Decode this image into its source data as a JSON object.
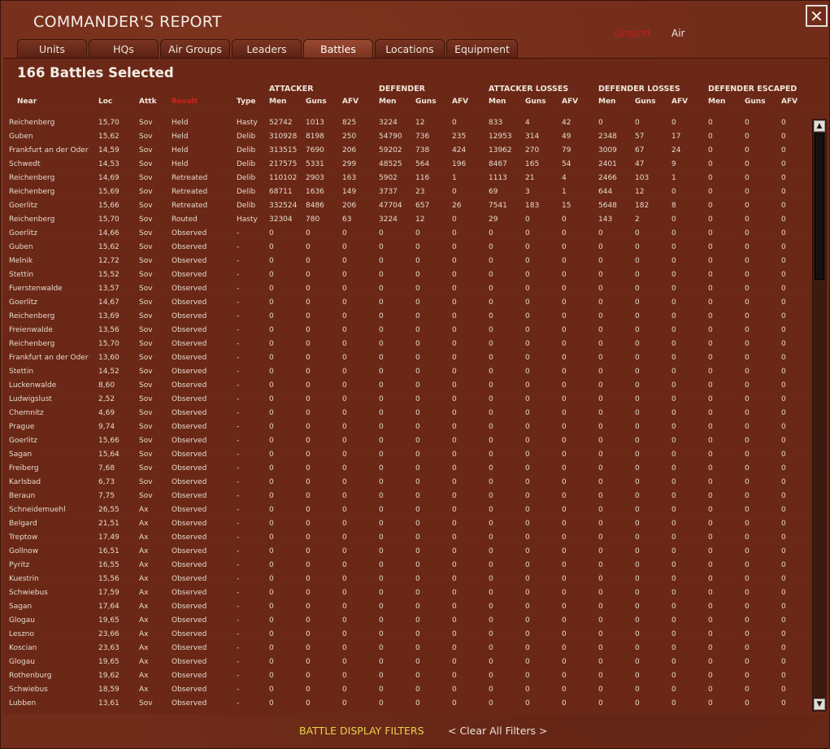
{
  "title": "COMMANDER'S REPORT",
  "close_label": "✕",
  "mode": {
    "ground": "Ground",
    "air": "Air"
  },
  "tabs": [
    "Units",
    "HQs",
    "Air Groups",
    "Leaders",
    "Battles",
    "Locations",
    "Equipment"
  ],
  "active_tab": "Battles",
  "selected_count": "166 Battles Selected",
  "group_headers": [
    "ATTACKER",
    "DEFENDER",
    "ATTACKER LOSSES",
    "DEFENDER LOSSES",
    "DEFENDER ESCAPED"
  ],
  "columns": [
    "Near",
    "Loc",
    "Attk",
    "Result",
    "Type",
    "Men",
    "Guns",
    "AFV",
    "Men",
    "Guns",
    "AFV",
    "Men",
    "Guns",
    "AFV",
    "Men",
    "Guns",
    "AFV",
    "Men",
    "Guns",
    "AFV"
  ],
  "sorted_column": "Result",
  "rows": [
    [
      "Reichenberg",
      "15,70",
      "Sov",
      "Held",
      "Hasty",
      "52742",
      "1013",
      "825",
      "3224",
      "12",
      "0",
      "833",
      "4",
      "42",
      "0",
      "0",
      "0",
      "0",
      "0",
      "0"
    ],
    [
      "Guben",
      "15,62",
      "Sov",
      "Held",
      "Delib",
      "310928",
      "8198",
      "250",
      "54790",
      "736",
      "235",
      "12953",
      "314",
      "49",
      "2348",
      "57",
      "17",
      "0",
      "0",
      "0"
    ],
    [
      "Frankfurt an der Oder",
      "14,59",
      "Sov",
      "Held",
      "Delib",
      "313515",
      "7690",
      "206",
      "59202",
      "738",
      "424",
      "13962",
      "270",
      "79",
      "3009",
      "67",
      "24",
      "0",
      "0",
      "0"
    ],
    [
      "Schwedt",
      "14,53",
      "Sov",
      "Held",
      "Delib",
      "217575",
      "5331",
      "299",
      "48525",
      "564",
      "196",
      "8467",
      "165",
      "54",
      "2401",
      "47",
      "9",
      "0",
      "0",
      "0"
    ],
    [
      "Reichenberg",
      "14,69",
      "Sov",
      "Retreated",
      "Delib",
      "110102",
      "2903",
      "163",
      "5902",
      "116",
      "1",
      "1113",
      "21",
      "4",
      "2466",
      "103",
      "1",
      "0",
      "0",
      "0"
    ],
    [
      "Reichenberg",
      "15,69",
      "Sov",
      "Retreated",
      "Delib",
      "68711",
      "1636",
      "149",
      "3737",
      "23",
      "0",
      "69",
      "3",
      "1",
      "644",
      "12",
      "0",
      "0",
      "0",
      "0"
    ],
    [
      "Goerlitz",
      "15,66",
      "Sov",
      "Retreated",
      "Delib",
      "332524",
      "8486",
      "206",
      "47704",
      "657",
      "26",
      "7541",
      "183",
      "15",
      "5648",
      "182",
      "8",
      "0",
      "0",
      "0"
    ],
    [
      "Reichenberg",
      "15,70",
      "Sov",
      "Routed",
      "Hasty",
      "32304",
      "780",
      "63",
      "3224",
      "12",
      "0",
      "29",
      "0",
      "0",
      "143",
      "2",
      "0",
      "0",
      "0",
      "0"
    ],
    [
      "Goerlitz",
      "14,66",
      "Sov",
      "Observed",
      "-",
      "0",
      "0",
      "0",
      "0",
      "0",
      "0",
      "0",
      "0",
      "0",
      "0",
      "0",
      "0",
      "0",
      "0",
      "0"
    ],
    [
      "Guben",
      "15,62",
      "Sov",
      "Observed",
      "-",
      "0",
      "0",
      "0",
      "0",
      "0",
      "0",
      "0",
      "0",
      "0",
      "0",
      "0",
      "0",
      "0",
      "0",
      "0"
    ],
    [
      "Melnik",
      "12,72",
      "Sov",
      "Observed",
      "-",
      "0",
      "0",
      "0",
      "0",
      "0",
      "0",
      "0",
      "0",
      "0",
      "0",
      "0",
      "0",
      "0",
      "0",
      "0"
    ],
    [
      "Stettin",
      "15,52",
      "Sov",
      "Observed",
      "-",
      "0",
      "0",
      "0",
      "0",
      "0",
      "0",
      "0",
      "0",
      "0",
      "0",
      "0",
      "0",
      "0",
      "0",
      "0"
    ],
    [
      "Fuerstenwalde",
      "13,57",
      "Sov",
      "Observed",
      "-",
      "0",
      "0",
      "0",
      "0",
      "0",
      "0",
      "0",
      "0",
      "0",
      "0",
      "0",
      "0",
      "0",
      "0",
      "0"
    ],
    [
      "Goerlitz",
      "14,67",
      "Sov",
      "Observed",
      "-",
      "0",
      "0",
      "0",
      "0",
      "0",
      "0",
      "0",
      "0",
      "0",
      "0",
      "0",
      "0",
      "0",
      "0",
      "0"
    ],
    [
      "Reichenberg",
      "13,69",
      "Sov",
      "Observed",
      "-",
      "0",
      "0",
      "0",
      "0",
      "0",
      "0",
      "0",
      "0",
      "0",
      "0",
      "0",
      "0",
      "0",
      "0",
      "0"
    ],
    [
      "Freienwalde",
      "13,56",
      "Sov",
      "Observed",
      "-",
      "0",
      "0",
      "0",
      "0",
      "0",
      "0",
      "0",
      "0",
      "0",
      "0",
      "0",
      "0",
      "0",
      "0",
      "0"
    ],
    [
      "Reichenberg",
      "15,70",
      "Sov",
      "Observed",
      "-",
      "0",
      "0",
      "0",
      "0",
      "0",
      "0",
      "0",
      "0",
      "0",
      "0",
      "0",
      "0",
      "0",
      "0",
      "0"
    ],
    [
      "Frankfurt an der Oder",
      "13,60",
      "Sov",
      "Observed",
      "-",
      "0",
      "0",
      "0",
      "0",
      "0",
      "0",
      "0",
      "0",
      "0",
      "0",
      "0",
      "0",
      "0",
      "0",
      "0"
    ],
    [
      "Stettin",
      "14,52",
      "Sov",
      "Observed",
      "-",
      "0",
      "0",
      "0",
      "0",
      "0",
      "0",
      "0",
      "0",
      "0",
      "0",
      "0",
      "0",
      "0",
      "0",
      "0"
    ],
    [
      "Luckenwalde",
      "8,60",
      "Sov",
      "Observed",
      "-",
      "0",
      "0",
      "0",
      "0",
      "0",
      "0",
      "0",
      "0",
      "0",
      "0",
      "0",
      "0",
      "0",
      "0",
      "0"
    ],
    [
      "Ludwigslust",
      "2,52",
      "Sov",
      "Observed",
      "-",
      "0",
      "0",
      "0",
      "0",
      "0",
      "0",
      "0",
      "0",
      "0",
      "0",
      "0",
      "0",
      "0",
      "0",
      "0"
    ],
    [
      "Chemnitz",
      "4,69",
      "Sov",
      "Observed",
      "-",
      "0",
      "0",
      "0",
      "0",
      "0",
      "0",
      "0",
      "0",
      "0",
      "0",
      "0",
      "0",
      "0",
      "0",
      "0"
    ],
    [
      "Prague",
      "9,74",
      "Sov",
      "Observed",
      "-",
      "0",
      "0",
      "0",
      "0",
      "0",
      "0",
      "0",
      "0",
      "0",
      "0",
      "0",
      "0",
      "0",
      "0",
      "0"
    ],
    [
      "Goerlitz",
      "15,66",
      "Sov",
      "Observed",
      "-",
      "0",
      "0",
      "0",
      "0",
      "0",
      "0",
      "0",
      "0",
      "0",
      "0",
      "0",
      "0",
      "0",
      "0",
      "0"
    ],
    [
      "Sagan",
      "15,64",
      "Sov",
      "Observed",
      "-",
      "0",
      "0",
      "0",
      "0",
      "0",
      "0",
      "0",
      "0",
      "0",
      "0",
      "0",
      "0",
      "0",
      "0",
      "0"
    ],
    [
      "Freiberg",
      "7,68",
      "Sov",
      "Observed",
      "-",
      "0",
      "0",
      "0",
      "0",
      "0",
      "0",
      "0",
      "0",
      "0",
      "0",
      "0",
      "0",
      "0",
      "0",
      "0"
    ],
    [
      "Karlsbad",
      "6,73",
      "Sov",
      "Observed",
      "-",
      "0",
      "0",
      "0",
      "0",
      "0",
      "0",
      "0",
      "0",
      "0",
      "0",
      "0",
      "0",
      "0",
      "0",
      "0"
    ],
    [
      "Beraun",
      "7,75",
      "Sov",
      "Observed",
      "-",
      "0",
      "0",
      "0",
      "0",
      "0",
      "0",
      "0",
      "0",
      "0",
      "0",
      "0",
      "0",
      "0",
      "0",
      "0"
    ],
    [
      "Schneidemuehl",
      "26,55",
      "Ax",
      "Observed",
      "-",
      "0",
      "0",
      "0",
      "0",
      "0",
      "0",
      "0",
      "0",
      "0",
      "0",
      "0",
      "0",
      "0",
      "0",
      "0"
    ],
    [
      "Belgard",
      "21,51",
      "Ax",
      "Observed",
      "-",
      "0",
      "0",
      "0",
      "0",
      "0",
      "0",
      "0",
      "0",
      "0",
      "0",
      "0",
      "0",
      "0",
      "0",
      "0"
    ],
    [
      "Treptow",
      "17,49",
      "Ax",
      "Observed",
      "-",
      "0",
      "0",
      "0",
      "0",
      "0",
      "0",
      "0",
      "0",
      "0",
      "0",
      "0",
      "0",
      "0",
      "0",
      "0"
    ],
    [
      "Gollnow",
      "16,51",
      "Ax",
      "Observed",
      "-",
      "0",
      "0",
      "0",
      "0",
      "0",
      "0",
      "0",
      "0",
      "0",
      "0",
      "0",
      "0",
      "0",
      "0",
      "0"
    ],
    [
      "Pyritz",
      "16,55",
      "Ax",
      "Observed",
      "-",
      "0",
      "0",
      "0",
      "0",
      "0",
      "0",
      "0",
      "0",
      "0",
      "0",
      "0",
      "0",
      "0",
      "0",
      "0"
    ],
    [
      "Kuestrin",
      "15,56",
      "Ax",
      "Observed",
      "-",
      "0",
      "0",
      "0",
      "0",
      "0",
      "0",
      "0",
      "0",
      "0",
      "0",
      "0",
      "0",
      "0",
      "0",
      "0"
    ],
    [
      "Schwiebus",
      "17,59",
      "Ax",
      "Observed",
      "-",
      "0",
      "0",
      "0",
      "0",
      "0",
      "0",
      "0",
      "0",
      "0",
      "0",
      "0",
      "0",
      "0",
      "0",
      "0"
    ],
    [
      "Sagan",
      "17,64",
      "Ax",
      "Observed",
      "-",
      "0",
      "0",
      "0",
      "0",
      "0",
      "0",
      "0",
      "0",
      "0",
      "0",
      "0",
      "0",
      "0",
      "0",
      "0"
    ],
    [
      "Glogau",
      "19,65",
      "Ax",
      "Observed",
      "-",
      "0",
      "0",
      "0",
      "0",
      "0",
      "0",
      "0",
      "0",
      "0",
      "0",
      "0",
      "0",
      "0",
      "0",
      "0"
    ],
    [
      "Leszno",
      "23,66",
      "Ax",
      "Observed",
      "-",
      "0",
      "0",
      "0",
      "0",
      "0",
      "0",
      "0",
      "0",
      "0",
      "0",
      "0",
      "0",
      "0",
      "0",
      "0"
    ],
    [
      "Koscian",
      "23,63",
      "Ax",
      "Observed",
      "-",
      "0",
      "0",
      "0",
      "0",
      "0",
      "0",
      "0",
      "0",
      "0",
      "0",
      "0",
      "0",
      "0",
      "0",
      "0"
    ],
    [
      "Glogau",
      "19,65",
      "Ax",
      "Observed",
      "-",
      "0",
      "0",
      "0",
      "0",
      "0",
      "0",
      "0",
      "0",
      "0",
      "0",
      "0",
      "0",
      "0",
      "0",
      "0"
    ],
    [
      "Rothenburg",
      "19,62",
      "Ax",
      "Observed",
      "-",
      "0",
      "0",
      "0",
      "0",
      "0",
      "0",
      "0",
      "0",
      "0",
      "0",
      "0",
      "0",
      "0",
      "0",
      "0"
    ],
    [
      "Schwiebus",
      "18,59",
      "Ax",
      "Observed",
      "-",
      "0",
      "0",
      "0",
      "0",
      "0",
      "0",
      "0",
      "0",
      "0",
      "0",
      "0",
      "0",
      "0",
      "0",
      "0"
    ],
    [
      "Lubben",
      "13,61",
      "Sov",
      "Observed",
      "-",
      "0",
      "0",
      "0",
      "0",
      "0",
      "0",
      "0",
      "0",
      "0",
      "0",
      "0",
      "0",
      "0",
      "0",
      "0"
    ]
  ],
  "scroll_up_icon": "▲",
  "scroll_down_icon": "▼",
  "footer": {
    "filters_label": "BATTLE DISPLAY FILTERS",
    "clear_label": "< Clear All Filters >"
  }
}
